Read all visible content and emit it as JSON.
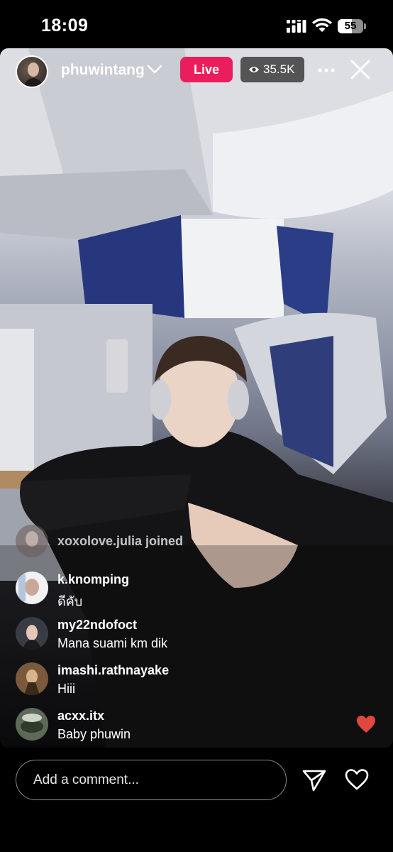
{
  "status_bar": {
    "time": "18:09",
    "battery_level": "55",
    "battery_fraction": 0.55
  },
  "header": {
    "host_username": "phuwintang",
    "live_label": "Live",
    "viewer_count": "35.5K"
  },
  "comments": [
    {
      "username": "xoxolove.julia joined",
      "text": "",
      "type": "joined"
    },
    {
      "username": "k.knomping",
      "text": "ดีคับ",
      "type": "comment"
    },
    {
      "username": "my22ndofoct",
      "text": "Mana suami km dik",
      "type": "comment"
    },
    {
      "username": "imashi.rathnayake",
      "text": "Hiii",
      "type": "comment"
    },
    {
      "username": "acxx.itx",
      "text": "Baby phuwin",
      "type": "comment"
    }
  ],
  "composer": {
    "placeholder": "Add a comment..."
  },
  "icons": [
    "signal-icon",
    "wifi-icon",
    "battery-icon",
    "chevron-down-icon",
    "eye-icon",
    "more-icon",
    "close-icon",
    "heart-icon",
    "send-icon",
    "like-icon"
  ],
  "colors": {
    "live_badge": "#ea1d5d",
    "heart": "#e0483f",
    "background": "#000000"
  }
}
